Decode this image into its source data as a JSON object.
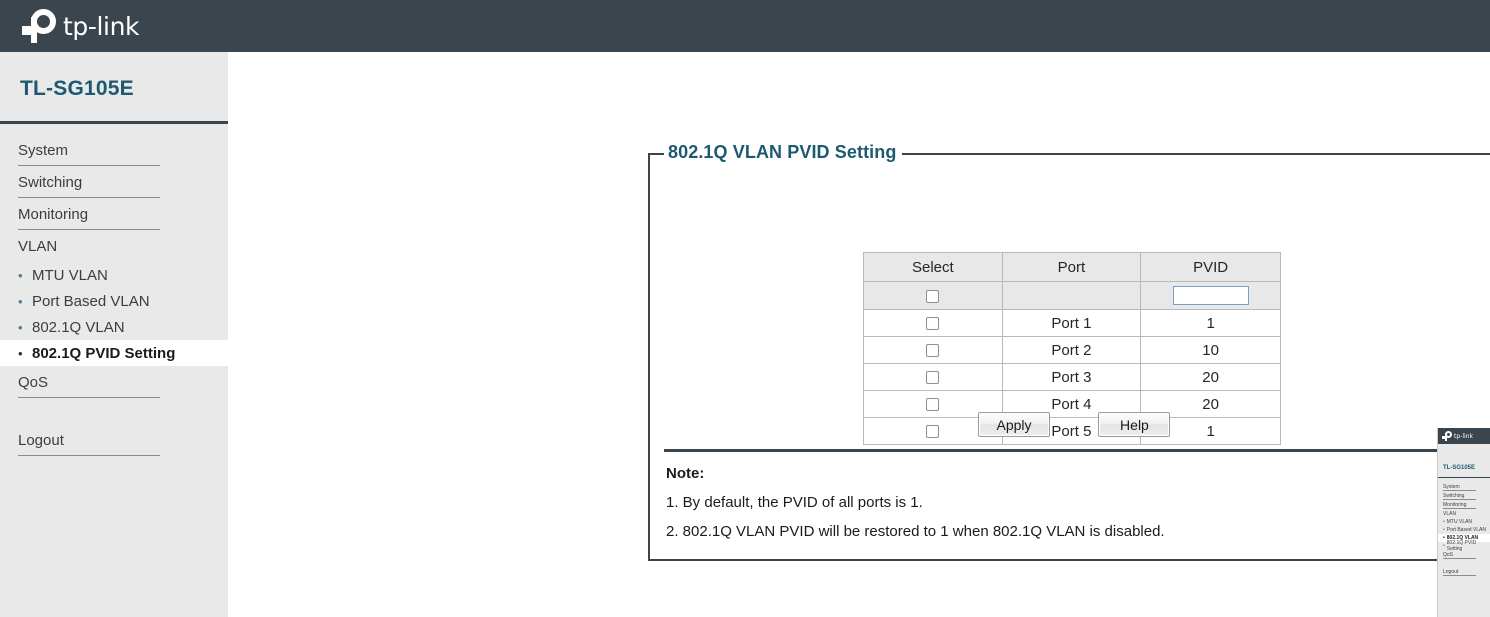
{
  "brand": {
    "logo_icon": "tplink-logo-icon",
    "logo_text": "tp-link",
    "bar_color": "#3a454e"
  },
  "sidebar": {
    "device_name": "TL-SG105E",
    "device_name_color": "#1d5a72",
    "background_color": "#e9e9e9",
    "top_items": [
      {
        "label": "System",
        "ruled": true
      },
      {
        "label": "Switching",
        "ruled": true
      },
      {
        "label": "Monitoring",
        "ruled": true
      },
      {
        "label": "VLAN",
        "ruled": false
      }
    ],
    "sub_items": [
      {
        "label": "MTU VLAN",
        "bullet": "•",
        "active": false
      },
      {
        "label": "Port Based VLAN",
        "bullet": "•",
        "active": false
      },
      {
        "label": "802.1Q VLAN",
        "bullet": "•",
        "active": false
      },
      {
        "label": "802.1Q PVID Setting",
        "bullet": "•",
        "active": true
      }
    ],
    "qos": {
      "label": "QoS",
      "ruled": true
    },
    "logout": {
      "label": "Logout",
      "ruled": true
    }
  },
  "main": {
    "panel_title": "802.1Q VLAN PVID Setting",
    "table": {
      "headers": [
        "Select",
        "Port",
        "PVID"
      ],
      "bulk_row": {
        "select_checked": false,
        "port": "",
        "pvid_value": "",
        "pvid_placeholder": ""
      },
      "rows": [
        {
          "select_checked": false,
          "port": "Port 1",
          "pvid": "1"
        },
        {
          "select_checked": false,
          "port": "Port 2",
          "pvid": "10"
        },
        {
          "select_checked": false,
          "port": "Port 3",
          "pvid": "20"
        },
        {
          "select_checked": false,
          "port": "Port 4",
          "pvid": "20"
        },
        {
          "select_checked": false,
          "port": "Port 5",
          "pvid": "1"
        }
      ]
    },
    "buttons": {
      "apply_label": "Apply",
      "help_label": "Help"
    },
    "note": {
      "title": "Note:",
      "lines": [
        "1. By default, the PVID of all ports is 1.",
        "2. 802.1Q VLAN PVID will be restored to 1 when 802.1Q VLAN is disabled."
      ]
    }
  },
  "mini_overlay": {
    "logo_text": "tp-link",
    "device_name": "TL-SG105E",
    "top_items": [
      {
        "label": "System",
        "ruled": true
      },
      {
        "label": "Switching",
        "ruled": true
      },
      {
        "label": "Monitoring",
        "ruled": true
      },
      {
        "label": "VLAN",
        "ruled": false
      }
    ],
    "sub_items": [
      {
        "label": "MTU VLAN",
        "bullet": "•",
        "active": false
      },
      {
        "label": "Port Based VLAN",
        "bullet": "•",
        "active": false
      },
      {
        "label": "802.1Q VLAN",
        "bullet": "•",
        "active": true
      },
      {
        "label": "802.1Q PVID Setting",
        "bullet": "•",
        "active": false
      }
    ],
    "qos": {
      "label": "QoS",
      "ruled": true
    },
    "logout": {
      "label": "Logout",
      "ruled": true
    }
  }
}
